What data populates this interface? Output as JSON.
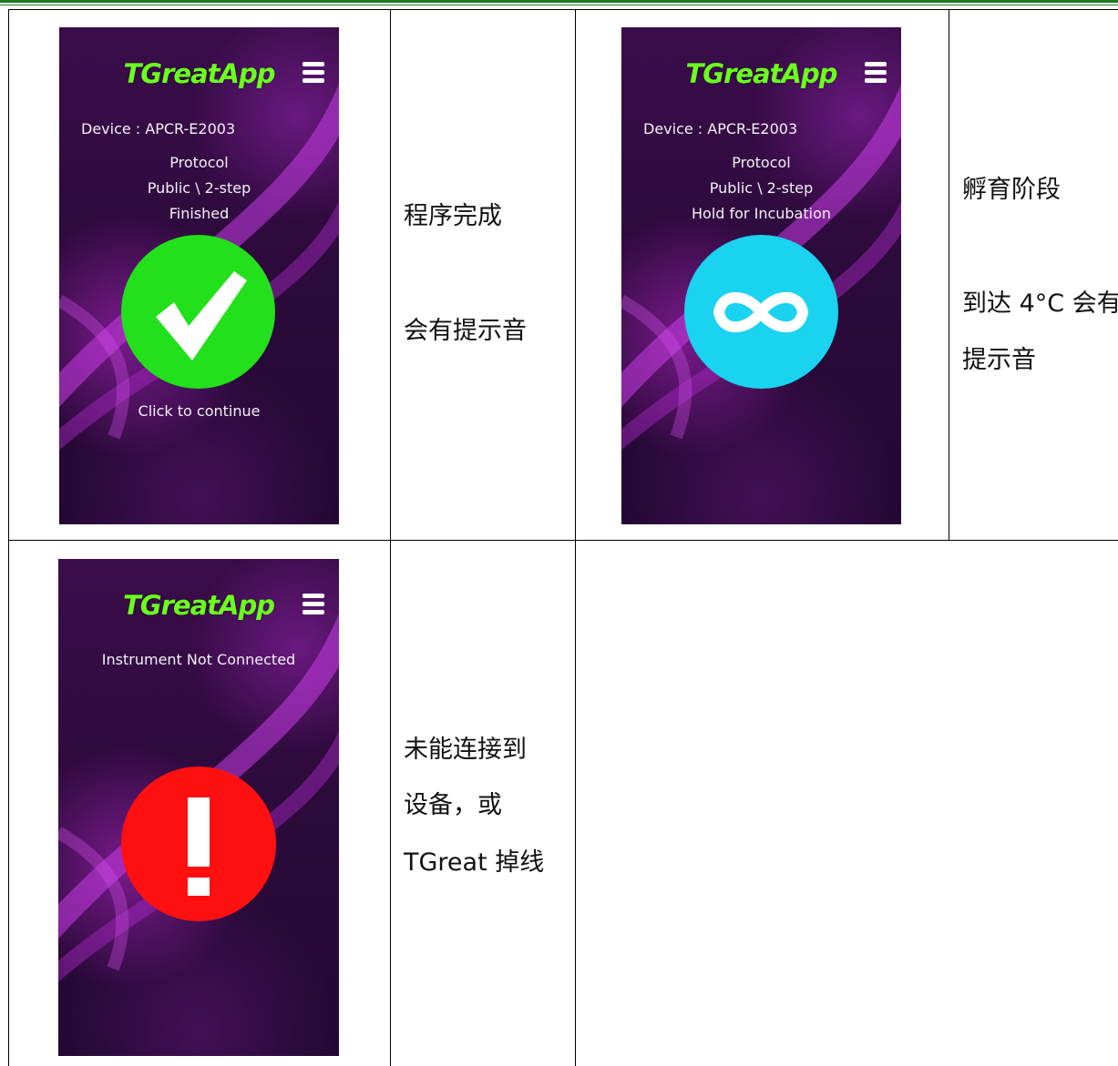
{
  "app_title": "TGreatApp",
  "colors": {
    "accent_green_title": "#6bff1e",
    "finished_circle": "#22e01c",
    "incubation_circle": "#19d3f0",
    "error_circle": "#ff1010",
    "rule": "#1f7a24"
  },
  "panel_finished": {
    "device": "Device : APCR-E2003",
    "protocol_label": "Protocol",
    "protocol_name": "Public \\ 2-step",
    "status": "Finished",
    "action": "Click to continue",
    "icon": "checkmark-icon",
    "description_line1": "程序完成",
    "description_line2": "会有提示音"
  },
  "panel_incubation": {
    "device": "Device : APCR-E2003",
    "protocol_label": "Protocol",
    "protocol_name": "Public \\ 2-step",
    "status": "Hold for Incubation",
    "icon": "infinity-icon",
    "description_line1": "孵育阶段",
    "description_line2": "到达 4°C 会有",
    "description_line3": "提示音"
  },
  "panel_error": {
    "status": "Instrument Not Connected",
    "icon": "exclamation-icon",
    "description_line1": "未能连接到",
    "description_line2": "设备，或",
    "description_line3": "TGreat  掉线"
  }
}
